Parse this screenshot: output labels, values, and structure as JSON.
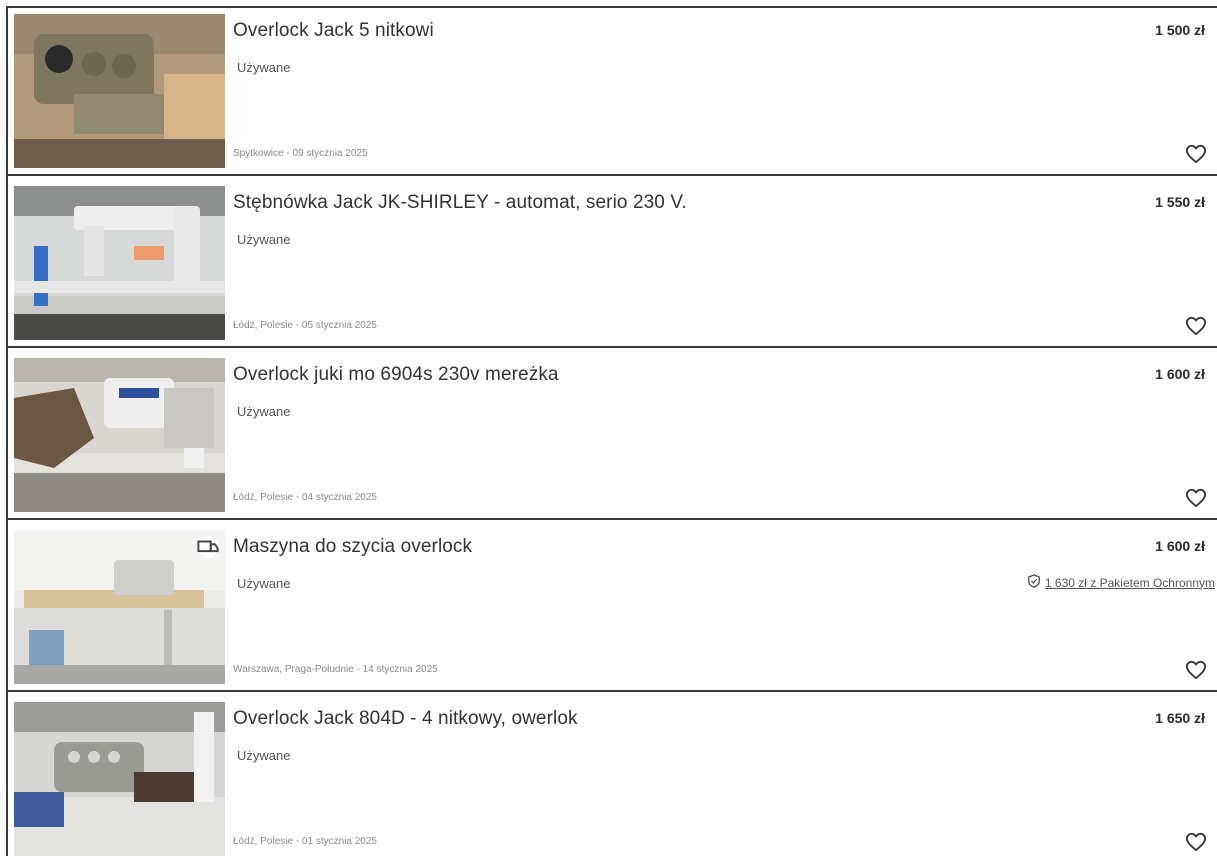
{
  "listings": [
    {
      "title": "Overlock Jack 5 nitkowi",
      "condition": "Używane",
      "location_date": "Spytkowice - 09 stycznia 2025",
      "price": "1 500 zł",
      "photo": "overlock-machine-photo"
    },
    {
      "title": "Stębnówka Jack JK-SHIRLEY - automat, serio 230 V.",
      "condition": "Używane",
      "location_date": "Łódź, Polesie - 05 stycznia 2025",
      "price": "1 550 zł",
      "photo": "lockstitch-machine-photo"
    },
    {
      "title": "Overlock juki mo 6904s 230v mereżka",
      "condition": "Używane",
      "location_date": "Łódź, Polesie - 04 stycznia 2025",
      "price": "1 600 zł",
      "photo": "overlock-table-photo"
    },
    {
      "title": "Maszyna do szycia overlock",
      "condition": "Używane",
      "location_date": "Warszawa, Praga-Południe - 14 stycznia 2025",
      "price": "1 600 zł",
      "protection_price": "1 630 zł z Pakietem Ochronnym",
      "photo": "sewing-table-photo",
      "badge_icon": "delivery-icon"
    },
    {
      "title": "Overlock Jack 804D - 4 nitkowy, owerlok",
      "condition": "Używane",
      "location_date": "Łódź, Polesie - 01 stycznia 2025",
      "price": "1 650 zł",
      "photo": "overlock-804d-photo"
    }
  ],
  "icons": {
    "favorite": "heart-icon",
    "protection": "shield-check-icon"
  },
  "colors": {
    "text": "#2b2b2b",
    "muted": "#8a8a8a",
    "border": "#3a3a3a"
  }
}
